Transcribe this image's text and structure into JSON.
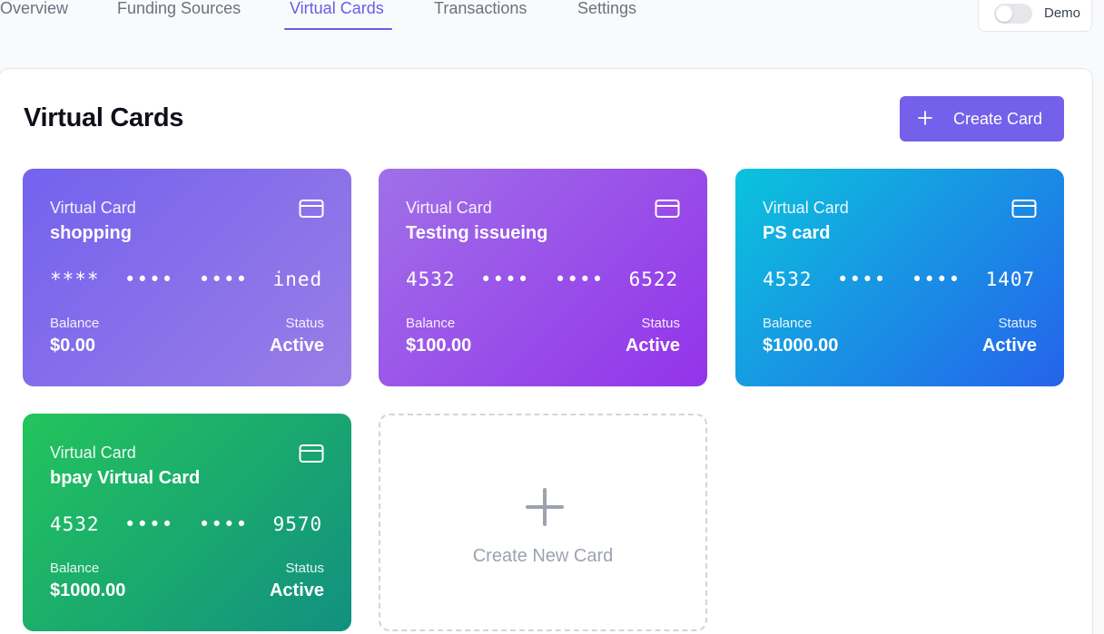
{
  "nav": {
    "tabs": [
      {
        "label": "Overview"
      },
      {
        "label": "Funding Sources"
      },
      {
        "label": "Virtual Cards"
      },
      {
        "label": "Transactions"
      },
      {
        "label": "Settings"
      }
    ],
    "active_tab": "Virtual Cards",
    "demo": {
      "label": "Demo",
      "enabled": false
    }
  },
  "main": {
    "title": "Virtual Cards",
    "create_button": {
      "icon": "plus-icon",
      "label": "Create Card"
    },
    "cards": [
      {
        "type_label": "Virtual Card",
        "name": "shopping",
        "number": "****  ••••  ••••  ined",
        "balance_label": "Balance",
        "balance": "$0.00",
        "status_label": "Status",
        "status": "Active",
        "color": "#7462ee"
      },
      {
        "type_label": "Virtual Card",
        "name": "Testing issueing",
        "number": "4532  ••••  ••••  6522",
        "balance_label": "Balance",
        "balance": "$100.00",
        "status_label": "Status",
        "status": "Active",
        "color": "#9333ea"
      },
      {
        "type_label": "Virtual Card",
        "name": "PS card",
        "number": "4532  ••••  ••••  1407",
        "balance_label": "Balance",
        "balance": "$1000.00",
        "status_label": "Status",
        "status": "Active",
        "color": "#2563eb"
      },
      {
        "type_label": "Virtual Card",
        "name": "bpay Virtual Card",
        "number": "4532  ••••  ••••  9570",
        "balance_label": "Balance",
        "balance": "$1000.00",
        "status_label": "Status",
        "status": "Active",
        "color": "#16a34a"
      }
    ],
    "new_card": {
      "icon": "plus-icon",
      "label": "Create New Card"
    }
  },
  "colors": {
    "accent": "#7460ea",
    "muted_text": "#6b7280"
  }
}
